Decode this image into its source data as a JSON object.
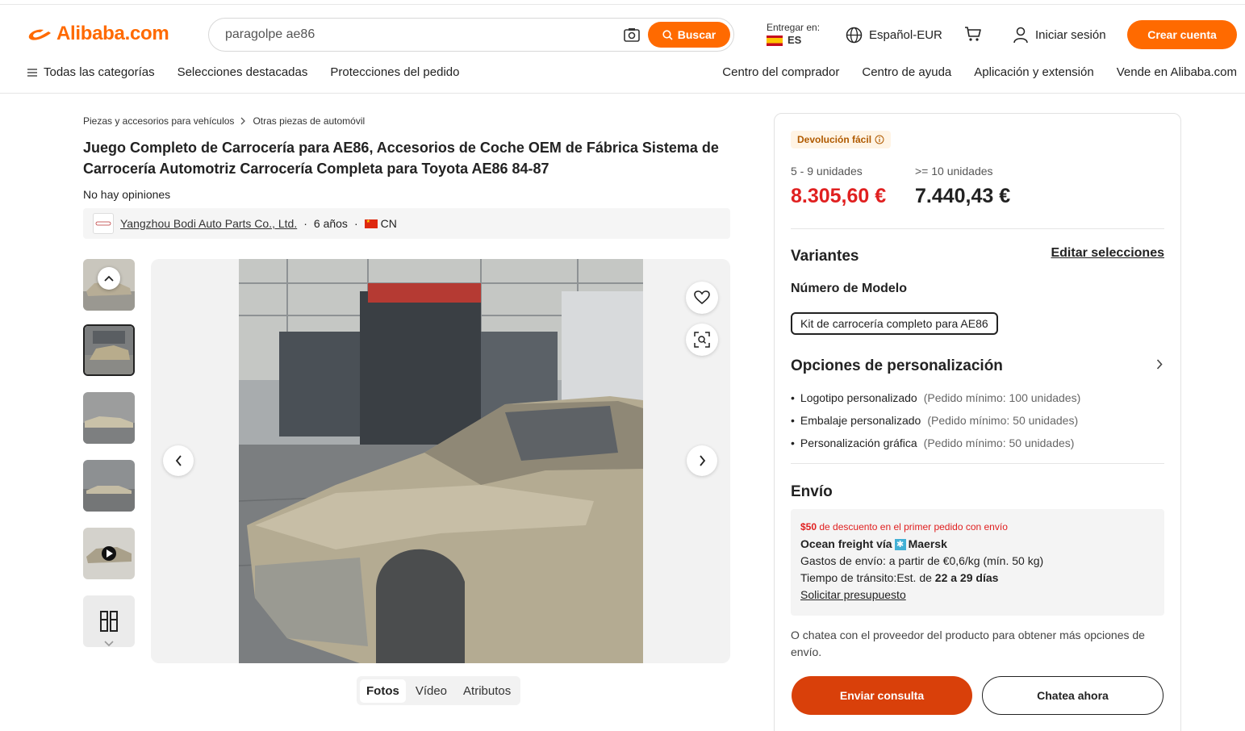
{
  "header": {
    "logo_text": "Alibaba.com",
    "search_value": "paragolpe ae86",
    "search_button": "Buscar",
    "deliver_label": "Entregar en:",
    "deliver_country": "ES",
    "language": "Español-EUR",
    "signin": "Iniciar sesión",
    "create_account": "Crear cuenta",
    "accent_color": "#ff6a00"
  },
  "nav": {
    "left": [
      "Todas las categorías",
      "Selecciones destacadas",
      "Protecciones del pedido"
    ],
    "right": [
      "Centro del comprador",
      "Centro de ayuda",
      "Aplicación y extensión",
      "Vende en Alibaba.com"
    ]
  },
  "breadcrumb": [
    "Piezas y accesorios para vehículos",
    "Otras piezas de automóvil"
  ],
  "product": {
    "title": "Juego Completo de Carrocería para AE86, Accesorios de Coche OEM de Fábrica Sistema de Carrocería Automotriz Carrocería Completa para Toyota AE86 84-87",
    "reviews": "No hay opiniones",
    "supplier_name": "Yangzhou Bodi Auto Parts Co., Ltd.",
    "supplier_years": "6 años",
    "supplier_country": "CN"
  },
  "media_tabs": [
    "Fotos",
    "Vídeo",
    "Atributos"
  ],
  "panel": {
    "badge": "Devolución fácil",
    "tiers": [
      {
        "range": "5 - 9 unidades",
        "price": "8.305,60 €"
      },
      {
        "range": ">= 10 unidades",
        "price": "7.440,43 €"
      }
    ],
    "variants_title": "Variantes",
    "edit_link": "Editar selecciones",
    "model_label": "Número de Modelo",
    "model_value": "Kit de carrocería completo para AE86",
    "custom_title": "Opciones de personalización",
    "custom_options": [
      {
        "name": "Logotipo personalizado",
        "min": "(Pedido mínimo: 100 unidades)"
      },
      {
        "name": "Embalaje personalizado",
        "min": "(Pedido mínimo: 50 unidades)"
      },
      {
        "name": "Personalización gráfica",
        "min": "(Pedido mínimo: 50 unidades)"
      }
    ],
    "shipping_title": "Envío",
    "ship_promo_amount": "$50",
    "ship_promo_text": "de descuento en el primer pedido con envío",
    "ship_method": "Ocean freight vía",
    "ship_carrier": "Maersk",
    "ship_cost": "Gastos de envío: a partir de €0,6/kg (mín. 50 kg)",
    "ship_time_label": "Tiempo de tránsito:Est. de",
    "ship_time_value": "22 a 29 días",
    "ship_quote": "Solicitar presupuesto",
    "chat_note": "O chatea con el proveedor del producto para obtener más opciones de envío.",
    "btn_inquiry": "Enviar consulta",
    "btn_chat": "Chatea ahora"
  }
}
